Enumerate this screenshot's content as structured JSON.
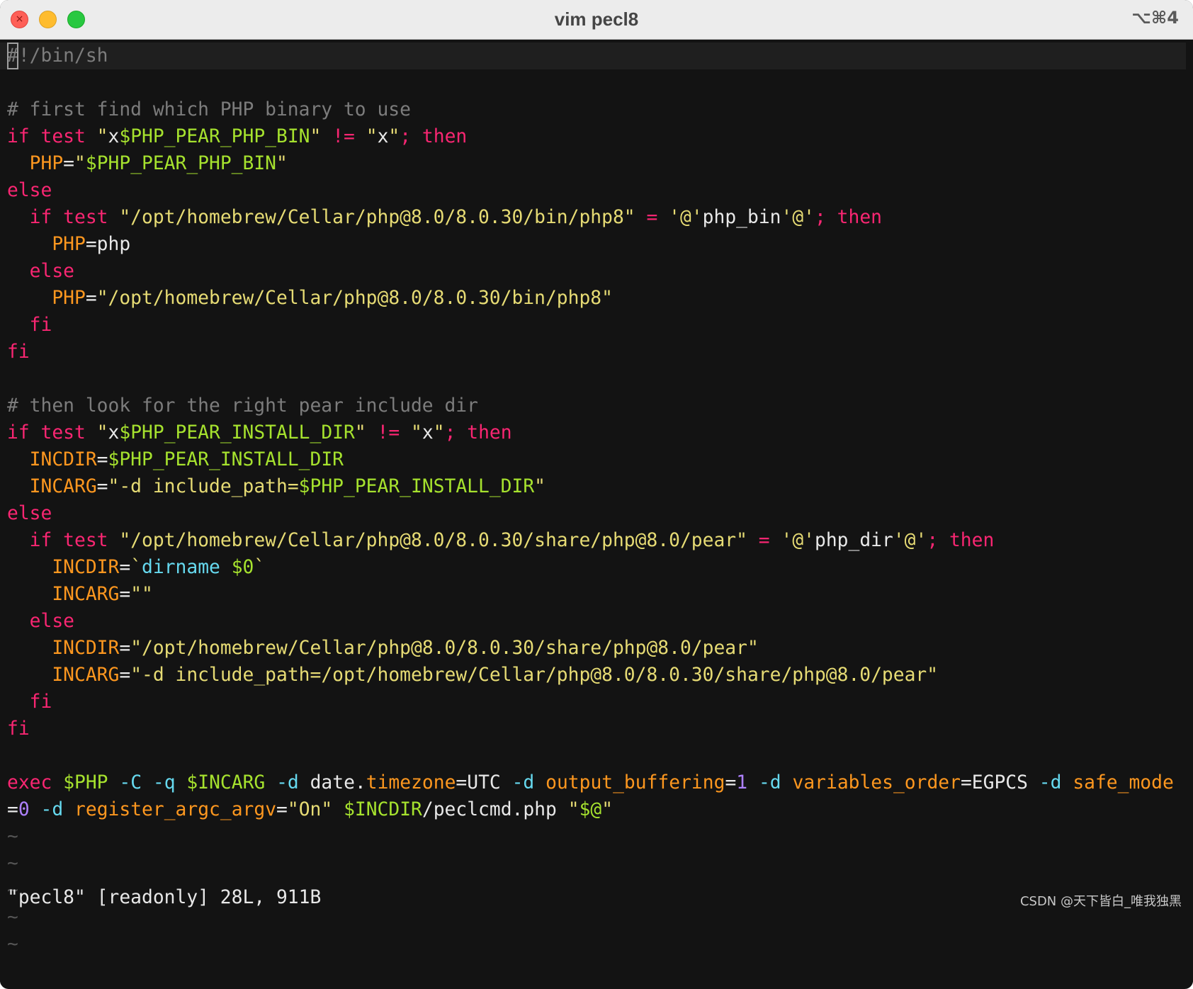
{
  "window": {
    "title": "vim pecl8",
    "shortcut": "⌥⌘4",
    "close_glyph": "×"
  },
  "theme": {
    "background": "#131313",
    "keyword": "#f92672",
    "variable": "#fd971f",
    "string": "#e6db74",
    "symbol": "#a6e22e",
    "option": "#66d9ef",
    "number": "#ae81ff",
    "comment": "#7c7c7c"
  },
  "editor": {
    "cursor_char": "#",
    "lines": [
      [
        [
          "comment",
          "!/bin/sh"
        ]
      ],
      [],
      [
        [
          "comment",
          "# first find which PHP binary to use"
        ]
      ],
      [
        [
          "kw",
          "if test "
        ],
        [
          "str",
          "\""
        ],
        [
          "plain",
          "x"
        ],
        [
          "sym",
          "$PHP_PEAR_PHP_BIN"
        ],
        [
          "str",
          "\""
        ],
        [
          "plain",
          " "
        ],
        [
          "kw",
          "!="
        ],
        [
          "plain",
          " "
        ],
        [
          "str",
          "\""
        ],
        [
          "plain",
          "x"
        ],
        [
          "str",
          "\""
        ],
        [
          "kw",
          "; then"
        ]
      ],
      [
        [
          "plain",
          "  "
        ],
        [
          "var",
          "PHP"
        ],
        [
          "plain",
          "="
        ],
        [
          "str",
          "\""
        ],
        [
          "sym",
          "$PHP_PEAR_PHP_BIN"
        ],
        [
          "str",
          "\""
        ]
      ],
      [
        [
          "kw",
          "else"
        ]
      ],
      [
        [
          "plain",
          "  "
        ],
        [
          "kw",
          "if test "
        ],
        [
          "str",
          "\"/opt/homebrew/Cellar/php@8.0/8.0.30/bin/php8\""
        ],
        [
          "plain",
          " "
        ],
        [
          "kw",
          "="
        ],
        [
          "plain",
          " "
        ],
        [
          "str",
          "'@'"
        ],
        [
          "plain",
          "php_bin"
        ],
        [
          "str",
          "'@'"
        ],
        [
          "kw",
          "; then"
        ]
      ],
      [
        [
          "plain",
          "    "
        ],
        [
          "var",
          "PHP"
        ],
        [
          "plain",
          "=php"
        ]
      ],
      [
        [
          "plain",
          "  "
        ],
        [
          "kw",
          "else"
        ]
      ],
      [
        [
          "plain",
          "    "
        ],
        [
          "var",
          "PHP"
        ],
        [
          "plain",
          "="
        ],
        [
          "str",
          "\"/opt/homebrew/Cellar/php@8.0/8.0.30/bin/php8\""
        ]
      ],
      [
        [
          "plain",
          "  "
        ],
        [
          "kw",
          "fi"
        ]
      ],
      [
        [
          "kw",
          "fi"
        ]
      ],
      [],
      [
        [
          "comment",
          "# then look for the right pear include dir"
        ]
      ],
      [
        [
          "kw",
          "if test "
        ],
        [
          "str",
          "\""
        ],
        [
          "plain",
          "x"
        ],
        [
          "sym",
          "$PHP_PEAR_INSTALL_DIR"
        ],
        [
          "str",
          "\""
        ],
        [
          "plain",
          " "
        ],
        [
          "kw",
          "!="
        ],
        [
          "plain",
          " "
        ],
        [
          "str",
          "\""
        ],
        [
          "plain",
          "x"
        ],
        [
          "str",
          "\""
        ],
        [
          "kw",
          "; then"
        ]
      ],
      [
        [
          "plain",
          "  "
        ],
        [
          "var",
          "INCDIR"
        ],
        [
          "plain",
          "="
        ],
        [
          "sym",
          "$PHP_PEAR_INSTALL_DIR"
        ]
      ],
      [
        [
          "plain",
          "  "
        ],
        [
          "var",
          "INCARG"
        ],
        [
          "plain",
          "="
        ],
        [
          "str",
          "\"-d include_path="
        ],
        [
          "sym",
          "$PHP_PEAR_INSTALL_DIR"
        ],
        [
          "str",
          "\""
        ]
      ],
      [
        [
          "kw",
          "else"
        ]
      ],
      [
        [
          "plain",
          "  "
        ],
        [
          "kw",
          "if test "
        ],
        [
          "str",
          "\"/opt/homebrew/Cellar/php@8.0/8.0.30/share/php@8.0/pear\""
        ],
        [
          "plain",
          " "
        ],
        [
          "kw",
          "="
        ],
        [
          "plain",
          " "
        ],
        [
          "str",
          "'@'"
        ],
        [
          "plain",
          "php_dir"
        ],
        [
          "str",
          "'@'"
        ],
        [
          "kw",
          "; then"
        ]
      ],
      [
        [
          "plain",
          "    "
        ],
        [
          "var",
          "INCDIR"
        ],
        [
          "plain",
          "="
        ],
        [
          "str",
          "`"
        ],
        [
          "opt",
          "dirname"
        ],
        [
          "plain",
          " "
        ],
        [
          "sym",
          "$0"
        ],
        [
          "str",
          "`"
        ]
      ],
      [
        [
          "plain",
          "    "
        ],
        [
          "var",
          "INCARG"
        ],
        [
          "plain",
          "="
        ],
        [
          "str",
          "\"\""
        ]
      ],
      [
        [
          "plain",
          "  "
        ],
        [
          "kw",
          "else"
        ]
      ],
      [
        [
          "plain",
          "    "
        ],
        [
          "var",
          "INCDIR"
        ],
        [
          "plain",
          "="
        ],
        [
          "str",
          "\"/opt/homebrew/Cellar/php@8.0/8.0.30/share/php@8.0/pear\""
        ]
      ],
      [
        [
          "plain",
          "    "
        ],
        [
          "var",
          "INCARG"
        ],
        [
          "plain",
          "="
        ],
        [
          "str",
          "\"-d include_path=/opt/homebrew/Cellar/php@8.0/8.0.30/share/php@8.0/pear\""
        ]
      ],
      [
        [
          "plain",
          "  "
        ],
        [
          "kw",
          "fi"
        ]
      ],
      [
        [
          "kw",
          "fi"
        ]
      ],
      [],
      [
        [
          "kw",
          "exec"
        ],
        [
          "plain",
          " "
        ],
        [
          "sym",
          "$PHP"
        ],
        [
          "plain",
          " "
        ],
        [
          "opt",
          "-C"
        ],
        [
          "plain",
          " "
        ],
        [
          "opt",
          "-q"
        ],
        [
          "plain",
          " "
        ],
        [
          "sym",
          "$INCARG"
        ],
        [
          "plain",
          " "
        ],
        [
          "opt",
          "-d"
        ],
        [
          "plain",
          " date."
        ],
        [
          "var",
          "timezone"
        ],
        [
          "plain",
          "=UTC "
        ],
        [
          "opt",
          "-d"
        ],
        [
          "plain",
          " "
        ],
        [
          "var",
          "output_buffering"
        ],
        [
          "plain",
          "="
        ],
        [
          "num",
          "1"
        ],
        [
          "plain",
          " "
        ],
        [
          "opt",
          "-d"
        ],
        [
          "plain",
          " "
        ],
        [
          "var",
          "variables_order"
        ],
        [
          "plain",
          "=EGPCS "
        ],
        [
          "opt",
          "-d"
        ],
        [
          "plain",
          " "
        ],
        [
          "var",
          "safe_mode"
        ]
      ],
      [
        [
          "plain",
          "="
        ],
        [
          "num",
          "0"
        ],
        [
          "plain",
          " "
        ],
        [
          "opt",
          "-d"
        ],
        [
          "plain",
          " "
        ],
        [
          "var",
          "register_argc_argv"
        ],
        [
          "plain",
          "="
        ],
        [
          "str",
          "\"On\""
        ],
        [
          "plain",
          " "
        ],
        [
          "sym",
          "$INCDIR"
        ],
        [
          "plain",
          "/peclcmd.php "
        ],
        [
          "str",
          "\""
        ],
        [
          "sym",
          "$@"
        ],
        [
          "str",
          "\""
        ]
      ],
      [
        [
          "tilde",
          "~"
        ]
      ],
      [
        [
          "tilde",
          "~"
        ]
      ],
      [
        [
          "tilde",
          "~"
        ]
      ],
      [
        [
          "tilde",
          "~"
        ]
      ],
      [
        [
          "tilde",
          "~"
        ]
      ]
    ]
  },
  "statusline": {
    "message": "\"pecl8\" [readonly] 28L, 911B"
  },
  "watermark": "CSDN @天下皆白_唯我独黑"
}
